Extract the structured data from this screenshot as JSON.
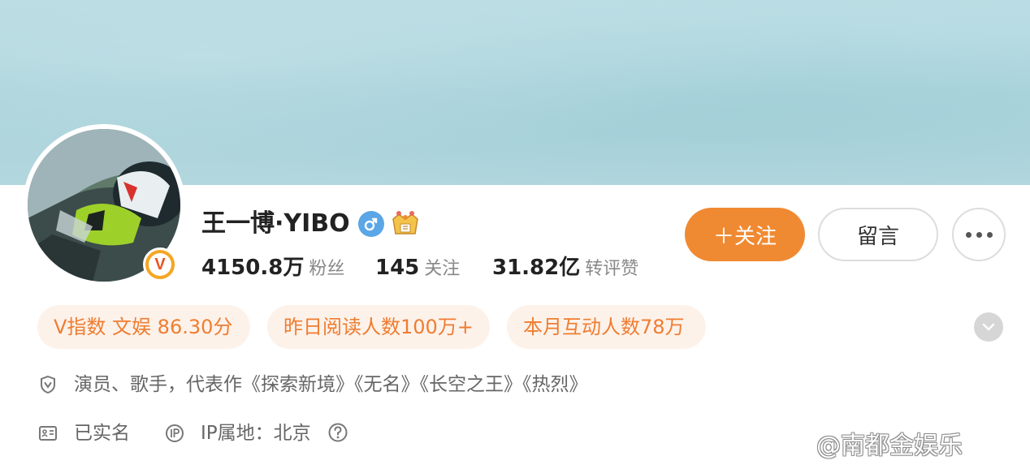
{
  "profile": {
    "name": "王一博·YIBO",
    "gender_icon": "male-icon",
    "badge_icon": "crown-level-icon",
    "verified_badge": "V"
  },
  "stats": [
    {
      "value": "4150.8万",
      "label": "粉丝"
    },
    {
      "value": "145",
      "label": "关注"
    },
    {
      "value": "31.82亿",
      "label": "转评赞"
    }
  ],
  "actions": {
    "follow_label": "＋关注",
    "message_label": "留言",
    "more_icon": "more-dots-icon"
  },
  "tags": [
    "V指数 文娱 86.30分",
    "昨日阅读人数100万+",
    "本月互动人数78万"
  ],
  "info": {
    "bio": "演员、歌手，代表作《探索新境》《无名》《长空之王》《热烈》",
    "verified": "已实名",
    "ip_location": "IP属地：北京"
  },
  "watermark": "@南都金娱乐",
  "colors": {
    "accent": "#f08a32",
    "tag_bg": "#fdf2ea",
    "tag_text": "#ef7d31",
    "gender": "#5aa6e6"
  }
}
